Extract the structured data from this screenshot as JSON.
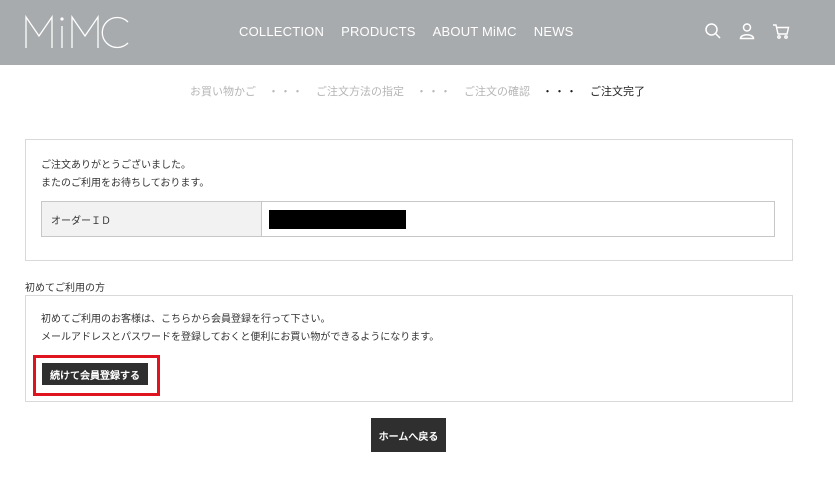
{
  "header": {
    "logo_text": "MiMC",
    "nav": [
      "COLLECTION",
      "PRODUCTS",
      "ABOUT MiMC",
      "NEWS"
    ],
    "icons": [
      "search-icon",
      "user-icon",
      "cart-icon"
    ],
    "background": "#a8abad"
  },
  "steps": {
    "items": [
      "お買い物かご",
      "ご注文方法の指定",
      "ご注文の確認",
      "ご注文完了"
    ],
    "separator": "・・・",
    "active_index": 3
  },
  "confirmation": {
    "message_line1": "ご注文ありがとうございました。",
    "message_line2": "またのご利用をお待ちしております。",
    "order_id_label": "オーダーＩＤ"
  },
  "first_time": {
    "title": "初めてご利用の方",
    "text_line1": "初めてご利用のお客様は、こちらから会員登録を行って下さい。",
    "text_line2": "メールアドレスとパスワードを登録しておくと便利にお買い物ができるようになります。",
    "register_button": "続けて会員登録する"
  },
  "home_button": "ホームへ戻る",
  "colors": {
    "button_bg": "#2f2f2f",
    "highlight": "#e0141e"
  }
}
